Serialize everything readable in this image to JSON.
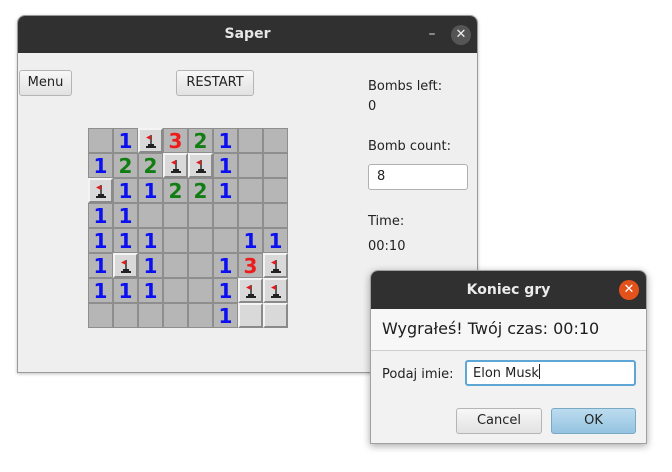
{
  "main_window": {
    "title": "Saper",
    "minimize": "–",
    "close": "✕",
    "menu_label": "Menu",
    "restart_label": "RESTART",
    "bombs_left_label": "Bombs left:",
    "bombs_left_value": "0",
    "bomb_count_label": "Bomb count:",
    "bomb_count_value": "8",
    "time_label": "Time:",
    "time_value": "00:10"
  },
  "board": {
    "rows": [
      [
        "",
        "1",
        "F",
        "3",
        "2",
        "1",
        "",
        ""
      ],
      [
        "1",
        "2",
        "2",
        "F",
        "F",
        "1",
        "",
        ""
      ],
      [
        "F",
        "1",
        "1",
        "2",
        "2",
        "1",
        "",
        ""
      ],
      [
        "1",
        "1",
        "",
        "",
        "",
        "",
        "",
        ""
      ],
      [
        "1",
        "1",
        "1",
        "",
        "",
        "",
        "1",
        "1"
      ],
      [
        "1",
        "F",
        "1",
        "",
        "",
        "1",
        "3",
        "F"
      ],
      [
        "1",
        "1",
        "1",
        "",
        "",
        "1",
        "F",
        "F"
      ],
      [
        "",
        "",
        "",
        "",
        "",
        "1",
        "#",
        "#"
      ]
    ]
  },
  "dialog": {
    "title": "Koniec gry",
    "close": "✕",
    "message": "Wygrałeś! Twój czas: 00:10",
    "name_label": "Podaj imie:",
    "name_value": "Elon Musk",
    "cancel_label": "Cancel",
    "ok_label": "OK"
  },
  "colors": {
    "number_1": "#0b10f0",
    "number_2": "#127d12",
    "number_3": "#ee1b1b",
    "dialog_close": "#e4521b",
    "ok_button": "#94c3e0"
  },
  "icons": {
    "flag": "flag-icon"
  }
}
